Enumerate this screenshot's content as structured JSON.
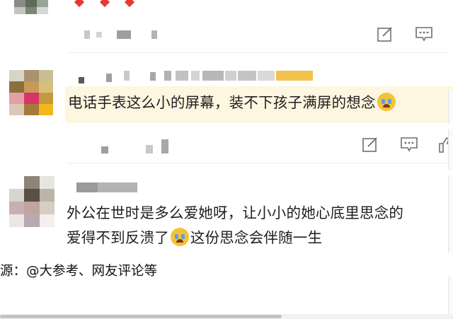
{
  "comments": [
    {
      "text": "电话手表这么小的屏幕，装不下孩子满屏的想念"
    },
    {
      "line1": "外公在世时是多么爱她呀，让小小的她心底里思念的",
      "line2_a": "爱得不到反溃了",
      "line2_b": "这份思念会伴随一生"
    }
  ],
  "source_text": "源：@大参考、网友评论等",
  "icons": [
    "edit-icon",
    "comment-icon",
    "like-icon",
    "crying-emoji",
    "heart-icon"
  ],
  "colors": {
    "highlight": "#fdf6e0",
    "text": "#1e1e1e",
    "icon": "#6f6f6f",
    "heart": "#e53935",
    "emoji": "#f4c23a"
  }
}
